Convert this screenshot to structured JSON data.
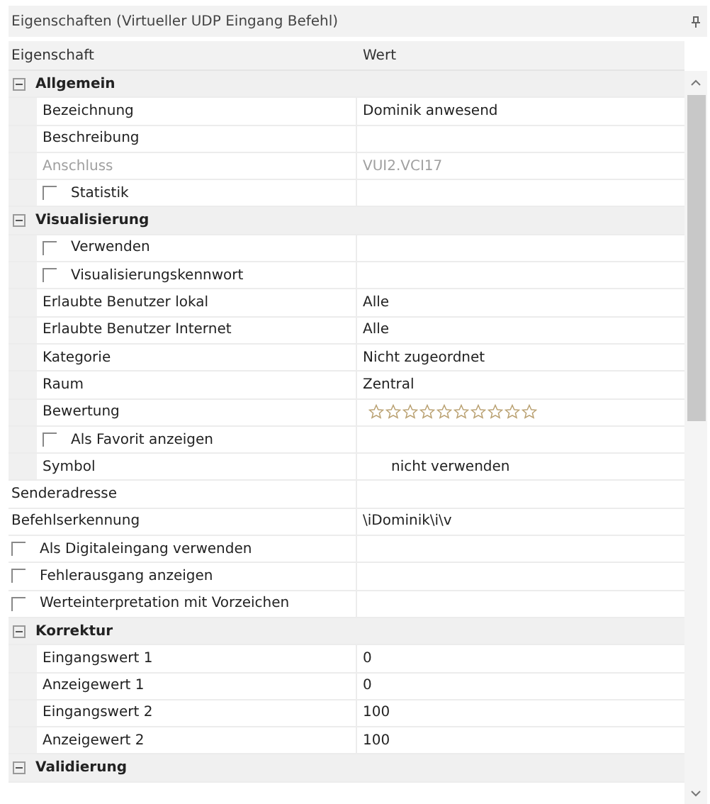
{
  "panel": {
    "title": "Eigenschaften (Virtueller UDP Eingang Befehl)"
  },
  "columns": [
    "Eigenschaft",
    "Wert"
  ],
  "rows": [
    {
      "kind": "category",
      "label": "Allgemein",
      "expanded": true,
      "children": [
        {
          "kind": "property",
          "label": "Bezeichnung",
          "value": "Dominik anwesend",
          "disabled": false
        },
        {
          "kind": "property",
          "label": "Beschreibung",
          "disabled": false
        },
        {
          "kind": "property",
          "label": "Anschluss",
          "value": "VUI2.VCI17",
          "disabled": true
        },
        {
          "kind": "checkbox",
          "label": "Statistik",
          "checked": false
        }
      ]
    },
    {
      "kind": "category",
      "label": "Visualisierung",
      "expanded": true,
      "children": [
        {
          "kind": "checkbox",
          "label": "Verwenden",
          "checked": false
        },
        {
          "kind": "checkbox",
          "label": "Visualisierungskennwort",
          "checked": false
        },
        {
          "kind": "property",
          "label": "Erlaubte Benutzer lokal",
          "value": "Alle",
          "disabled": false
        },
        {
          "kind": "property",
          "label": "Erlaubte Benutzer Internet",
          "value": "Alle",
          "disabled": false
        },
        {
          "kind": "property",
          "label": "Kategorie",
          "value": "Nicht zugeordnet",
          "disabled": false
        },
        {
          "kind": "property",
          "label": "Raum",
          "value": "Zentral",
          "disabled": false
        },
        {
          "kind": "rating",
          "label": "Bewertung",
          "stars": 0
        },
        {
          "kind": "checkbox",
          "label": "Als Favorit anzeigen",
          "checked": false
        },
        {
          "kind": "symbol",
          "label": "Symbol",
          "value": "nicht verwenden"
        }
      ]
    },
    {
      "kind": "property",
      "label": "Senderadresse",
      "disabled": false
    },
    {
      "kind": "property",
      "label": "Befehlserkennung",
      "value": "\\iDominik\\i\\v",
      "disabled": false
    },
    {
      "kind": "checkbox",
      "label": "Als Digitaleingang verwenden",
      "checked": false
    },
    {
      "kind": "checkbox",
      "label": "Fehlerausgang anzeigen",
      "checked": false
    },
    {
      "kind": "checkbox",
      "label": "Werteinterpretation mit Vorzeichen",
      "checked": false
    },
    {
      "kind": "category",
      "label": "Korrektur",
      "expanded": true,
      "children": [
        {
          "kind": "property",
          "label": "Eingangswert 1",
          "value": "0",
          "disabled": false
        },
        {
          "kind": "property",
          "label": "Anzeigewert 1",
          "value": "0",
          "disabled": false
        },
        {
          "kind": "property",
          "label": "Eingangswert 2",
          "value": "100",
          "disabled": false
        },
        {
          "kind": "property",
          "label": "Anzeigewert 2",
          "value": "100",
          "disabled": false
        }
      ]
    },
    {
      "kind": "category",
      "label": "Validierung",
      "expanded": true
    }
  ]
}
